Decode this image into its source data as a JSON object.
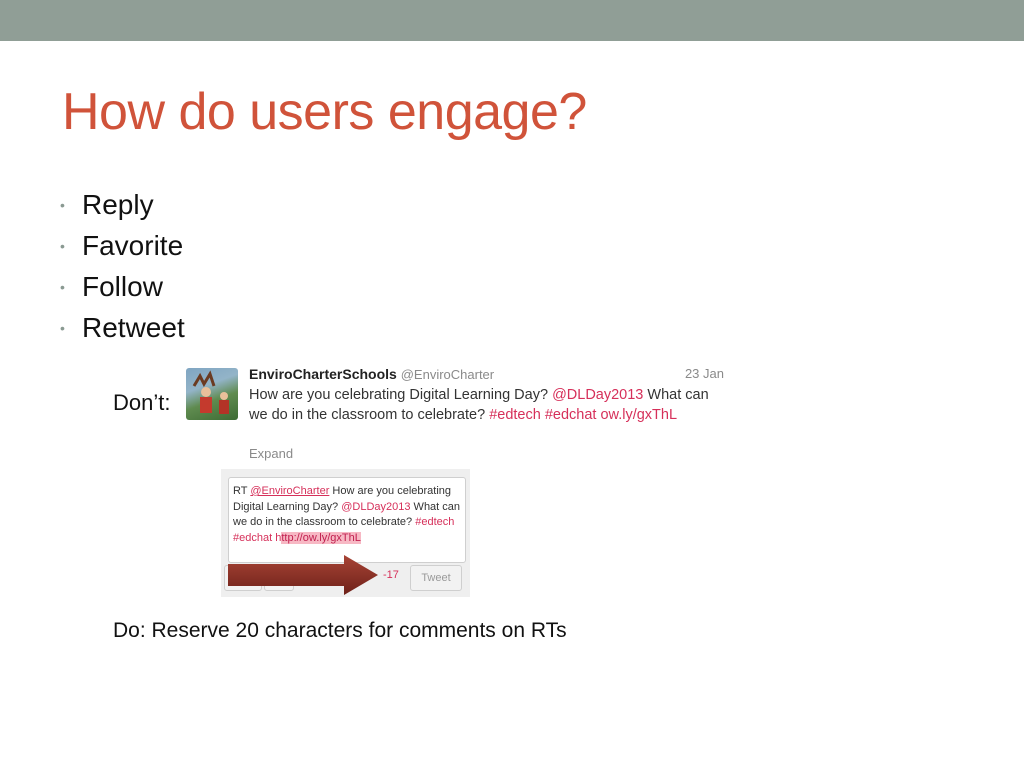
{
  "slide": {
    "title": "How do users engage?",
    "bullets": [
      "Reply",
      "Favorite",
      "Follow",
      "Retweet"
    ],
    "dont_label": "Don’t:",
    "do_text": "Do: Reserve 20 characters for comments on RTs"
  },
  "tweet": {
    "name": "EnviroCharterSchools",
    "handle": "@EnviroCharter",
    "date": "23 Jan",
    "text_1": "How are you celebrating Digital Learning Day? ",
    "mention": "@DLDay2013",
    "text_2": " What can we do in the classroom to celebrate? ",
    "hashtag_1": "#edtech",
    "hashtag_2": "#edchat",
    "link": "ow.ly/gxThL",
    "expand": "Expand"
  },
  "compose": {
    "rt": "RT ",
    "mention_1": "@EnviroCharter",
    "text_1": " How are you celebrating Digital Learning Day? ",
    "mention_2": "@DLDay2013",
    "text_2": " What can we do in the classroom to celebrate? ",
    "hashtag_1": "#edtech",
    "hashtag_2": "#edchat",
    "link_start": "h",
    "link_over": "ttp://ow.ly/gxThL",
    "counter": "-17",
    "tweet_button": "Tweet"
  },
  "colors": {
    "title": "#d0533a",
    "top_bar": "#909e96",
    "highlight": "#d6305a",
    "arrow": "#8b2e24"
  }
}
